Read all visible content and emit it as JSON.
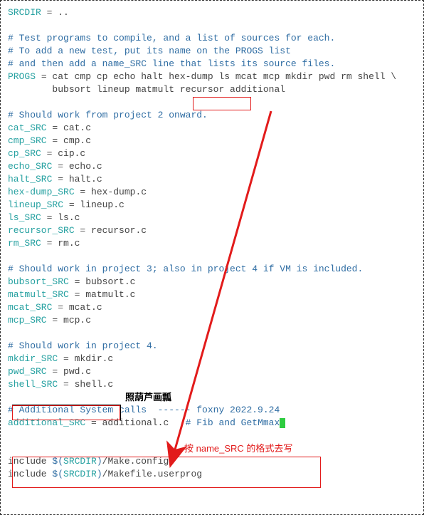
{
  "srcdir_line": {
    "var": "SRCDIR",
    "eq": " = ",
    "val": ".."
  },
  "comments1": [
    "# Test programs to compile, and a list of sources for each.",
    "# To add a new test, put its name on the PROGS list",
    "# and then add a name_SRC line that lists its source files."
  ],
  "progs": {
    "var": "PROGS",
    "eq": " = ",
    "val1": "cat cmp cp echo halt hex-dump ls mcat mcp mkdir pwd rm shell \\",
    "val2": "        bubsort lineup matmult recursor additional"
  },
  "comment2": "# Should work from project 2 onward.",
  "group1": [
    {
      "var": "cat_SRC",
      "val": "cat.c"
    },
    {
      "var": "cmp_SRC",
      "val": "cmp.c"
    },
    {
      "var": "cp_SRC",
      "val": "cip.c"
    },
    {
      "var": "echo_SRC",
      "val": "echo.c"
    },
    {
      "var": "halt_SRC",
      "val": "halt.c"
    },
    {
      "var": "hex-dump_SRC",
      "val": "hex-dump.c"
    },
    {
      "var": "lineup_SRC",
      "val": "lineup.c"
    },
    {
      "var": "ls_SRC",
      "val": "ls.c"
    },
    {
      "var": "recursor_SRC",
      "val": "recursor.c"
    },
    {
      "var": "rm_SRC",
      "val": "rm.c"
    }
  ],
  "comment3": "# Should work in project 3; also in project 4 if VM is included.",
  "group2": [
    {
      "var": "bubsort_SRC",
      "val": "bubsort.c"
    },
    {
      "var": "matmult_SRC",
      "val": "matmult.c"
    },
    {
      "var": "mcat_SRC",
      "val": "mcat.c"
    },
    {
      "var": "mcp_SRC",
      "val": "mcp.c"
    }
  ],
  "comment4": "# Should work in project 4.",
  "group3": [
    {
      "var": "mkdir_SRC",
      "val": "mkdir.c"
    },
    {
      "var": "pwd_SRC",
      "val": "pwd.c"
    },
    {
      "var": "shell_SRC",
      "val": "shell.c"
    }
  ],
  "comment5": "# Additional System calls  ------ foxny 2022.9.24",
  "additional": {
    "var": "additional_SRC",
    "val": "additional.c",
    "trail": "   # Fib and GetMmax"
  },
  "includes": [
    {
      "kw": "include ",
      "d1": "$(",
      "v": "SRCDIR",
      "d2": ")",
      "rest": "/Make.config"
    },
    {
      "kw": "include ",
      "d1": "$(",
      "v": "SRCDIR",
      "d2": ")",
      "rest": "/Makefile.userprog"
    }
  ],
  "anno_black": "照葫芦画瓢",
  "anno_red": "按 name_SRC 的格式去写"
}
